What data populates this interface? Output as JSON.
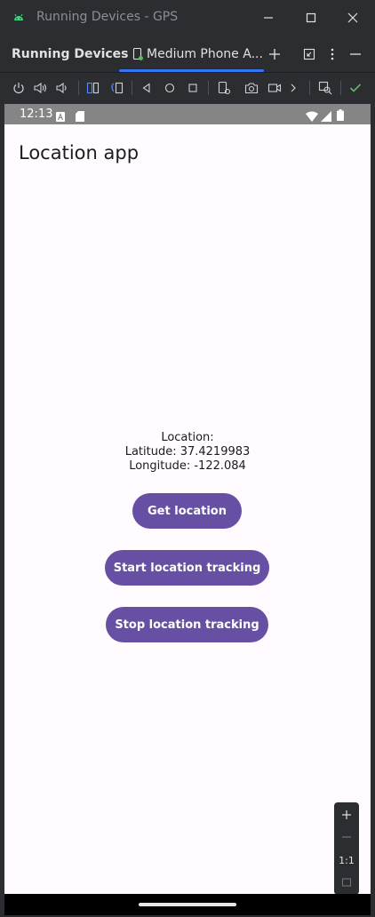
{
  "window": {
    "title": "Running Devices - GPS"
  },
  "tabbar": {
    "tool_title": "Running Devices",
    "tab_label": "Medium Phone A..."
  },
  "device": {
    "status": {
      "time": "12:13"
    },
    "app_title": "Location app",
    "location": {
      "header": "Location:",
      "latitude": "Latitude: 37.4219983",
      "longitude": "Longitude: -122.084"
    },
    "buttons": {
      "get_location": "Get location",
      "start_tracking": "Start location tracking",
      "stop_tracking": "Stop location tracking"
    }
  },
  "zoom": {
    "actual_size": "1:1"
  },
  "colors": {
    "primary": "#6750a4",
    "accent": "#3574f0",
    "success": "#5fb865",
    "android_green": "#3ddc84"
  }
}
